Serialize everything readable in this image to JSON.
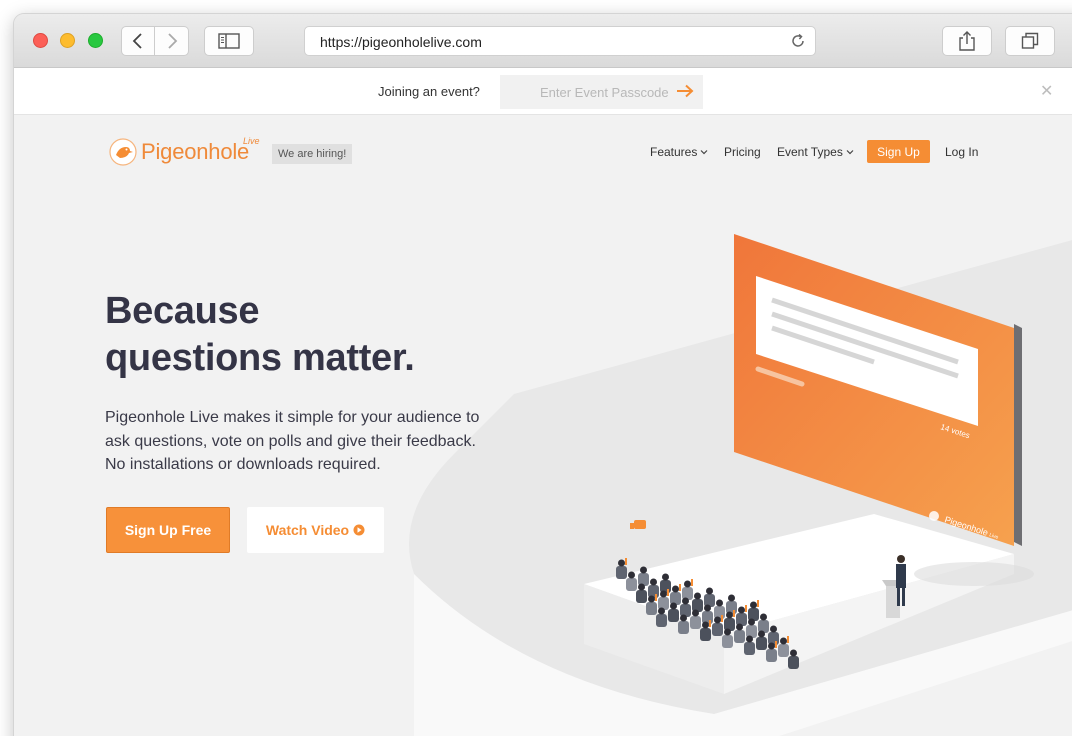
{
  "browser": {
    "url": "https://pigeonholelive.com"
  },
  "passcode_bar": {
    "label": "Joining an event?",
    "placeholder": "Enter Event Passcode"
  },
  "site": {
    "logo_text": "Pigeonhole",
    "logo_live": "Live",
    "hiring_badge": "We are hiring!",
    "nav": {
      "features": "Features",
      "pricing": "Pricing",
      "event_types": "Event Types",
      "signup": "Sign Up",
      "login": "Log In"
    }
  },
  "hero": {
    "title_lines": [
      "Because",
      "questions matter."
    ],
    "description_lines": [
      "Pigeonhole Live makes it simple for your audience to",
      "ask questions, vote on polls and give their feedback.",
      "No installations or downloads required."
    ],
    "primary_cta": "Sign Up Free",
    "secondary_cta": "Watch Video"
  },
  "illustration": {
    "screen_votes": "14 votes",
    "screen_logo": "Pigeonhole",
    "screen_logo_sup": "Live"
  },
  "colors": {
    "accent": "#f58d34",
    "heading": "#343446",
    "background": "#f2f2f2"
  }
}
